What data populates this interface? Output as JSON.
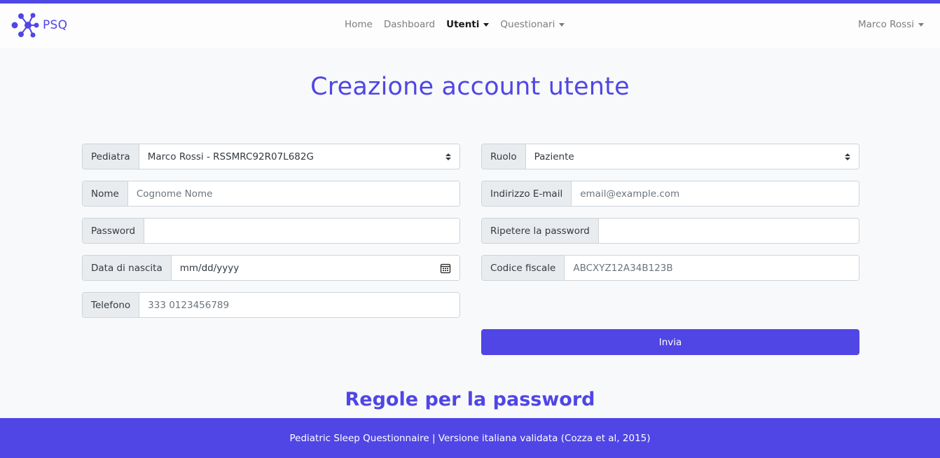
{
  "colors": {
    "accent": "#4f46e5"
  },
  "brand": {
    "name": "PSQ",
    "icon": "psq-logo-icon"
  },
  "nav": {
    "home": "Home",
    "dashboard": "Dashboard",
    "utenti": "Utenti",
    "questionari": "Questionari",
    "user": "Marco Rossi"
  },
  "page": {
    "title": "Creazione account utente"
  },
  "form": {
    "pediatra": {
      "label": "Pediatra",
      "value": "Marco Rossi - RSSMRC92R07L682G"
    },
    "ruolo": {
      "label": "Ruolo",
      "value": "Paziente"
    },
    "nome": {
      "label": "Nome",
      "placeholder": "Cognome Nome"
    },
    "email": {
      "label": "Indirizzo E-mail",
      "placeholder": "email@example.com"
    },
    "password": {
      "label": "Password",
      "placeholder": ""
    },
    "password_repeat": {
      "label": "Ripetere la password",
      "placeholder": ""
    },
    "data_nascita": {
      "label": "Data di nascita",
      "placeholder": "mm/dd/yyyy",
      "icon": "calendar-icon"
    },
    "codice_fiscale": {
      "label": "Codice fiscale",
      "placeholder": "ABCXYZ12A34B123B"
    },
    "telefono": {
      "label": "Telefono",
      "placeholder": "333 0123456789"
    },
    "submit_label": "Invia"
  },
  "rules": {
    "title": "Regole per la password"
  },
  "footer": {
    "text": "Pediatric Sleep Questionnaire | Versione italiana validata (Cozza et al, 2015)"
  }
}
